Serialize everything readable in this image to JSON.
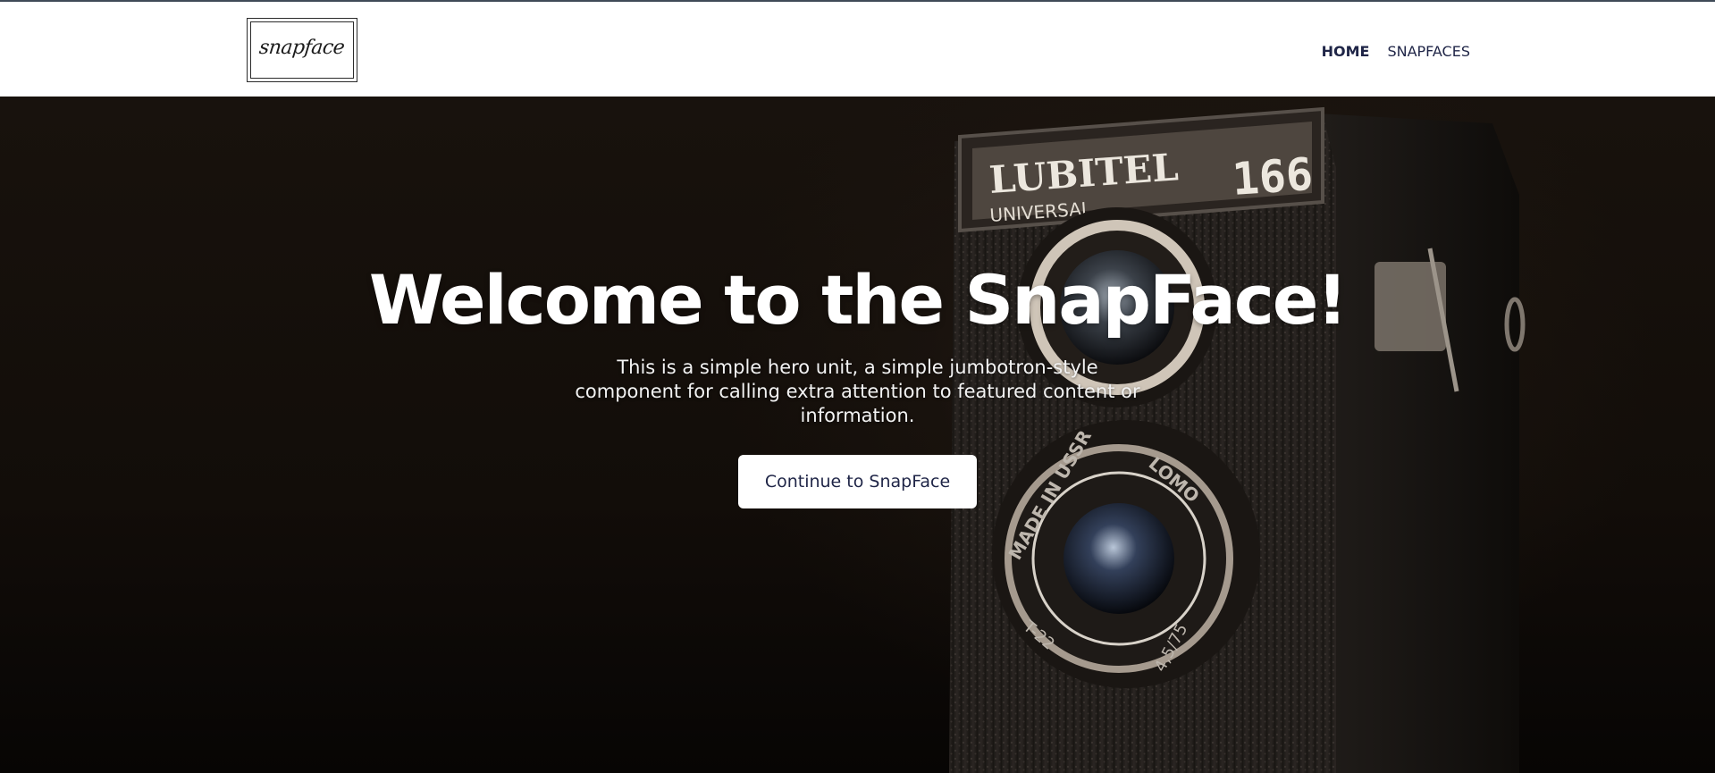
{
  "header": {
    "logo_text": "snapface",
    "nav": [
      {
        "label": "HOME",
        "active": true
      },
      {
        "label": "SNAPFACES",
        "active": false
      }
    ]
  },
  "hero": {
    "title": "Welcome to the SnapFace!",
    "lead": "This is a simple hero unit, a simple jumbotron-style component for calling extra attention to featured content or information.",
    "button_label": "Continue to SnapFace",
    "background_image": {
      "camera_brand": "LUBITEL",
      "camera_model": "166",
      "camera_subtitle": "UNIVERSAL",
      "lens_text_1": "MADE IN USSR",
      "lens_text_2": "LOMO",
      "lens_text_3": "T-22",
      "lens_text_4": "4,5/75"
    }
  },
  "colors": {
    "nav_text": "#1f2547",
    "hero_background": "#120d09",
    "button_background": "#ffffff"
  }
}
